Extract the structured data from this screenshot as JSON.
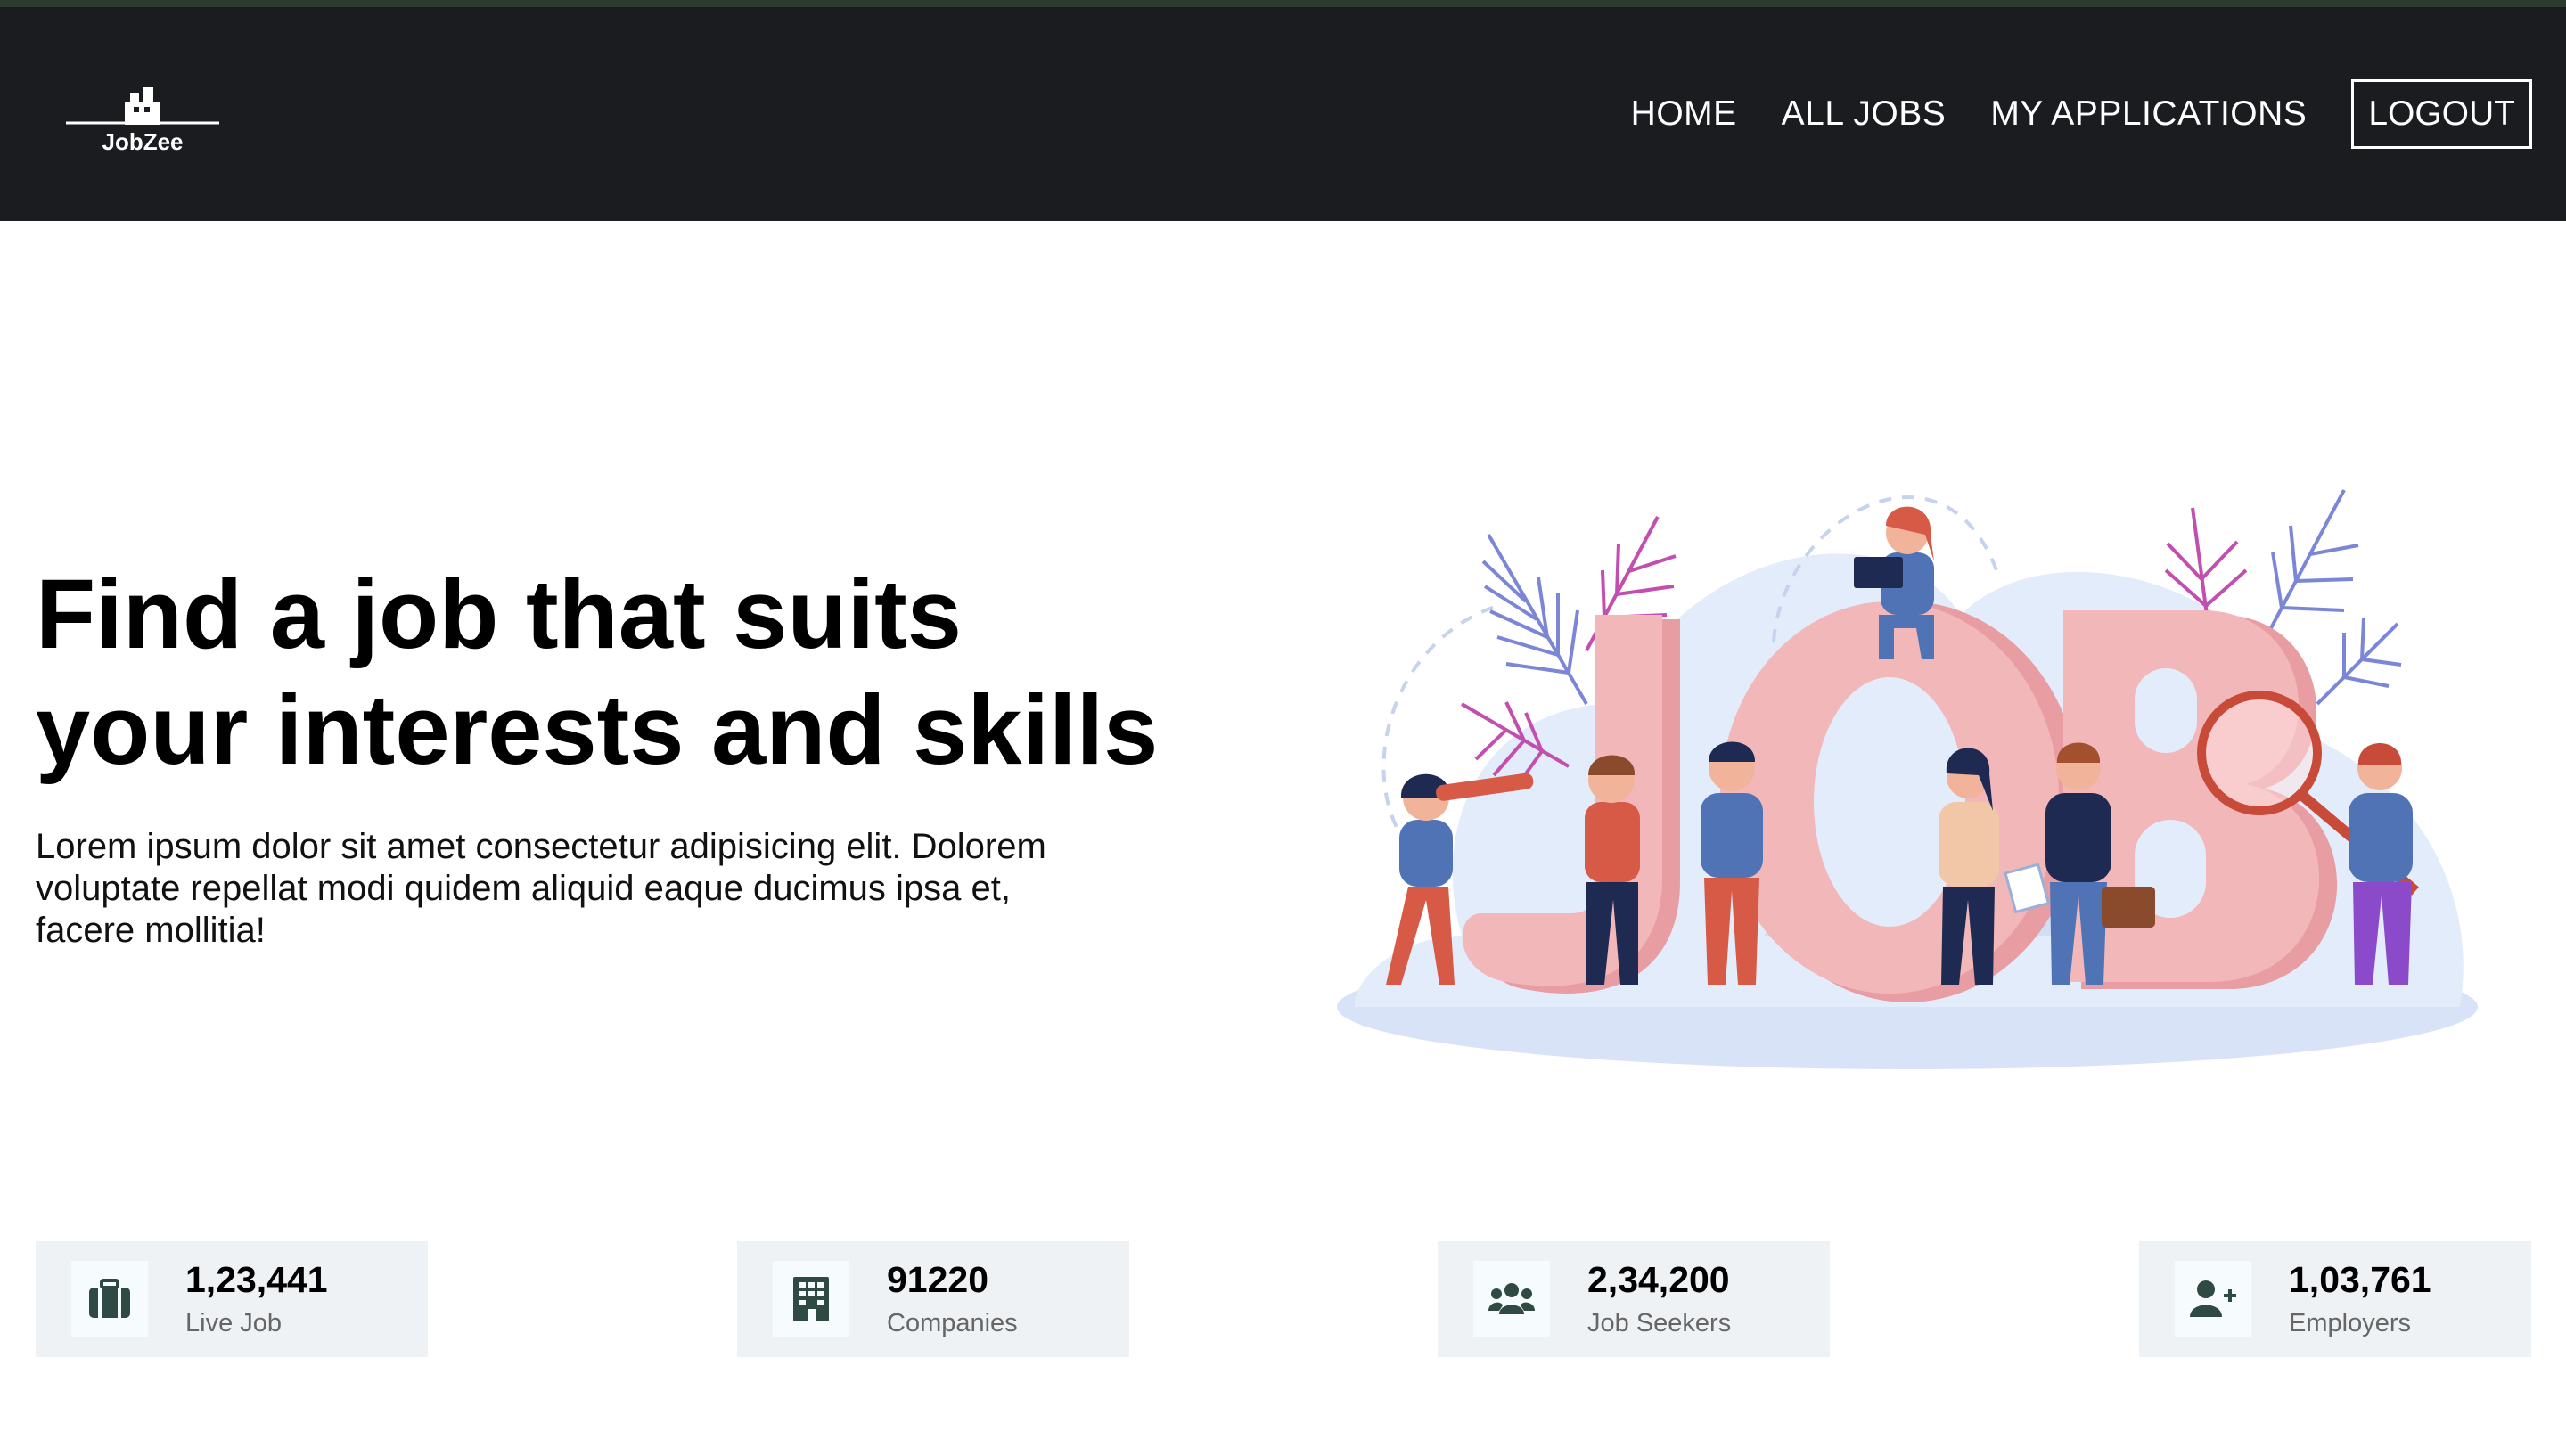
{
  "brand": {
    "name": "JobZee"
  },
  "nav": {
    "items": [
      "HOME",
      "ALL JOBS",
      "MY APPLICATIONS"
    ],
    "logout": "LOGOUT"
  },
  "hero": {
    "title_line1": "Find a job that suits",
    "title_line2": "your interests and skills",
    "text": "Lorem ipsum dolor sit amet consectetur adipisicing elit. Dolorem voluptate repellat modi quidem aliquid eaque ducimus ipsa et, facere mollitia!",
    "illustration_letters": "JOB"
  },
  "stats": [
    {
      "value": "1,23,441",
      "label": "Live Job",
      "icon": "briefcase-icon"
    },
    {
      "value": "91220",
      "label": "Companies",
      "icon": "building-icon"
    },
    {
      "value": "2,34,200",
      "label": "Job Seekers",
      "icon": "users-icon"
    },
    {
      "value": "1,03,761",
      "label": "Employers",
      "icon": "user-plus-icon"
    }
  ],
  "colors": {
    "navbar": "#1b1c1f",
    "stat_card": "#eff2f5",
    "icon_color": "#2f4a42",
    "letters": "#f0b4b6"
  }
}
